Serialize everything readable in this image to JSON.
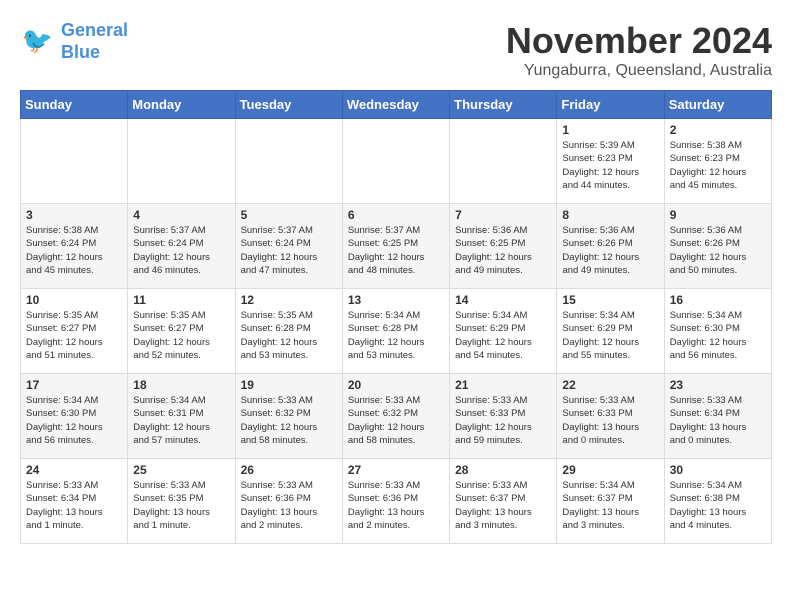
{
  "logo": {
    "line1": "General",
    "line2": "Blue"
  },
  "title": "November 2024",
  "location": "Yungaburra, Queensland, Australia",
  "days_of_week": [
    "Sunday",
    "Monday",
    "Tuesday",
    "Wednesday",
    "Thursday",
    "Friday",
    "Saturday"
  ],
  "weeks": [
    [
      {
        "day": "",
        "info": ""
      },
      {
        "day": "",
        "info": ""
      },
      {
        "day": "",
        "info": ""
      },
      {
        "day": "",
        "info": ""
      },
      {
        "day": "",
        "info": ""
      },
      {
        "day": "1",
        "info": "Sunrise: 5:39 AM\nSunset: 6:23 PM\nDaylight: 12 hours\nand 44 minutes."
      },
      {
        "day": "2",
        "info": "Sunrise: 5:38 AM\nSunset: 6:23 PM\nDaylight: 12 hours\nand 45 minutes."
      }
    ],
    [
      {
        "day": "3",
        "info": "Sunrise: 5:38 AM\nSunset: 6:24 PM\nDaylight: 12 hours\nand 45 minutes."
      },
      {
        "day": "4",
        "info": "Sunrise: 5:37 AM\nSunset: 6:24 PM\nDaylight: 12 hours\nand 46 minutes."
      },
      {
        "day": "5",
        "info": "Sunrise: 5:37 AM\nSunset: 6:24 PM\nDaylight: 12 hours\nand 47 minutes."
      },
      {
        "day": "6",
        "info": "Sunrise: 5:37 AM\nSunset: 6:25 PM\nDaylight: 12 hours\nand 48 minutes."
      },
      {
        "day": "7",
        "info": "Sunrise: 5:36 AM\nSunset: 6:25 PM\nDaylight: 12 hours\nand 49 minutes."
      },
      {
        "day": "8",
        "info": "Sunrise: 5:36 AM\nSunset: 6:26 PM\nDaylight: 12 hours\nand 49 minutes."
      },
      {
        "day": "9",
        "info": "Sunrise: 5:36 AM\nSunset: 6:26 PM\nDaylight: 12 hours\nand 50 minutes."
      }
    ],
    [
      {
        "day": "10",
        "info": "Sunrise: 5:35 AM\nSunset: 6:27 PM\nDaylight: 12 hours\nand 51 minutes."
      },
      {
        "day": "11",
        "info": "Sunrise: 5:35 AM\nSunset: 6:27 PM\nDaylight: 12 hours\nand 52 minutes."
      },
      {
        "day": "12",
        "info": "Sunrise: 5:35 AM\nSunset: 6:28 PM\nDaylight: 12 hours\nand 53 minutes."
      },
      {
        "day": "13",
        "info": "Sunrise: 5:34 AM\nSunset: 6:28 PM\nDaylight: 12 hours\nand 53 minutes."
      },
      {
        "day": "14",
        "info": "Sunrise: 5:34 AM\nSunset: 6:29 PM\nDaylight: 12 hours\nand 54 minutes."
      },
      {
        "day": "15",
        "info": "Sunrise: 5:34 AM\nSunset: 6:29 PM\nDaylight: 12 hours\nand 55 minutes."
      },
      {
        "day": "16",
        "info": "Sunrise: 5:34 AM\nSunset: 6:30 PM\nDaylight: 12 hours\nand 56 minutes."
      }
    ],
    [
      {
        "day": "17",
        "info": "Sunrise: 5:34 AM\nSunset: 6:30 PM\nDaylight: 12 hours\nand 56 minutes."
      },
      {
        "day": "18",
        "info": "Sunrise: 5:34 AM\nSunset: 6:31 PM\nDaylight: 12 hours\nand 57 minutes."
      },
      {
        "day": "19",
        "info": "Sunrise: 5:33 AM\nSunset: 6:32 PM\nDaylight: 12 hours\nand 58 minutes."
      },
      {
        "day": "20",
        "info": "Sunrise: 5:33 AM\nSunset: 6:32 PM\nDaylight: 12 hours\nand 58 minutes."
      },
      {
        "day": "21",
        "info": "Sunrise: 5:33 AM\nSunset: 6:33 PM\nDaylight: 12 hours\nand 59 minutes."
      },
      {
        "day": "22",
        "info": "Sunrise: 5:33 AM\nSunset: 6:33 PM\nDaylight: 13 hours\nand 0 minutes."
      },
      {
        "day": "23",
        "info": "Sunrise: 5:33 AM\nSunset: 6:34 PM\nDaylight: 13 hours\nand 0 minutes."
      }
    ],
    [
      {
        "day": "24",
        "info": "Sunrise: 5:33 AM\nSunset: 6:34 PM\nDaylight: 13 hours\nand 1 minute."
      },
      {
        "day": "25",
        "info": "Sunrise: 5:33 AM\nSunset: 6:35 PM\nDaylight: 13 hours\nand 1 minute."
      },
      {
        "day": "26",
        "info": "Sunrise: 5:33 AM\nSunset: 6:36 PM\nDaylight: 13 hours\nand 2 minutes."
      },
      {
        "day": "27",
        "info": "Sunrise: 5:33 AM\nSunset: 6:36 PM\nDaylight: 13 hours\nand 2 minutes."
      },
      {
        "day": "28",
        "info": "Sunrise: 5:33 AM\nSunset: 6:37 PM\nDaylight: 13 hours\nand 3 minutes."
      },
      {
        "day": "29",
        "info": "Sunrise: 5:34 AM\nSunset: 6:37 PM\nDaylight: 13 hours\nand 3 minutes."
      },
      {
        "day": "30",
        "info": "Sunrise: 5:34 AM\nSunset: 6:38 PM\nDaylight: 13 hours\nand 4 minutes."
      }
    ]
  ]
}
